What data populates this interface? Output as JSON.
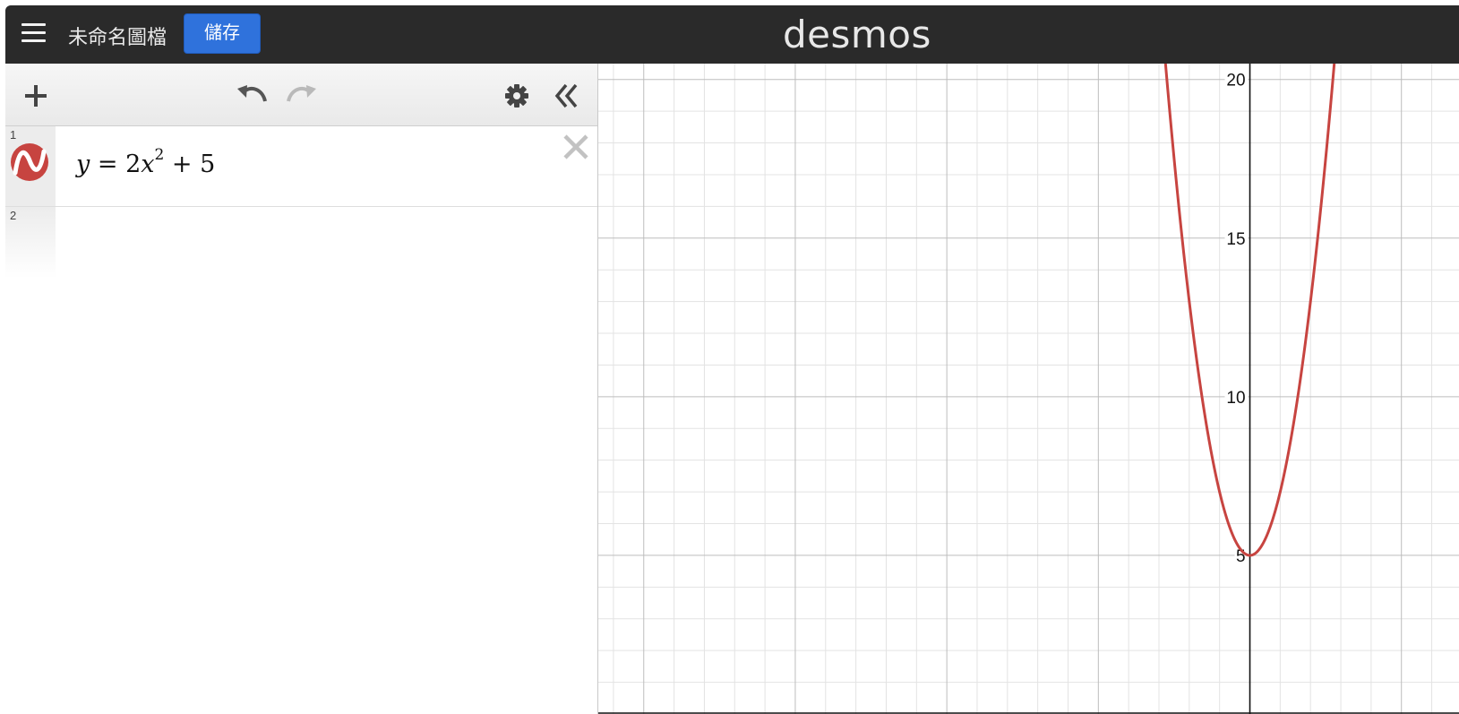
{
  "header": {
    "title": "未命名圖檔",
    "save_label": "儲存",
    "logo": "desmos",
    "menu_icon": "hamburger-icon"
  },
  "toolbar": {
    "icons": [
      "add-icon",
      "undo-icon",
      "redo-icon",
      "gear-icon",
      "collapse-icon"
    ]
  },
  "expressions": [
    {
      "index": "1",
      "latex_parts": {
        "y": "y",
        "eq": "=",
        "coef": "2",
        "x": "x",
        "exp": "2",
        "plus": "+",
        "const": "5"
      },
      "color": "#c74440"
    },
    {
      "index": "2"
    }
  ],
  "graph": {
    "y_ticks": [
      "20",
      "15",
      "10",
      "5"
    ],
    "curve": {
      "a": 2,
      "c": 5,
      "color": "#c74440"
    },
    "x_view": [
      -21.5,
      6.9
    ],
    "y_view": [
      0,
      20.5
    ]
  },
  "colors": {
    "header_bg": "#2a2a2a",
    "save_button": "#2f72dc",
    "curve": "#c74440"
  }
}
